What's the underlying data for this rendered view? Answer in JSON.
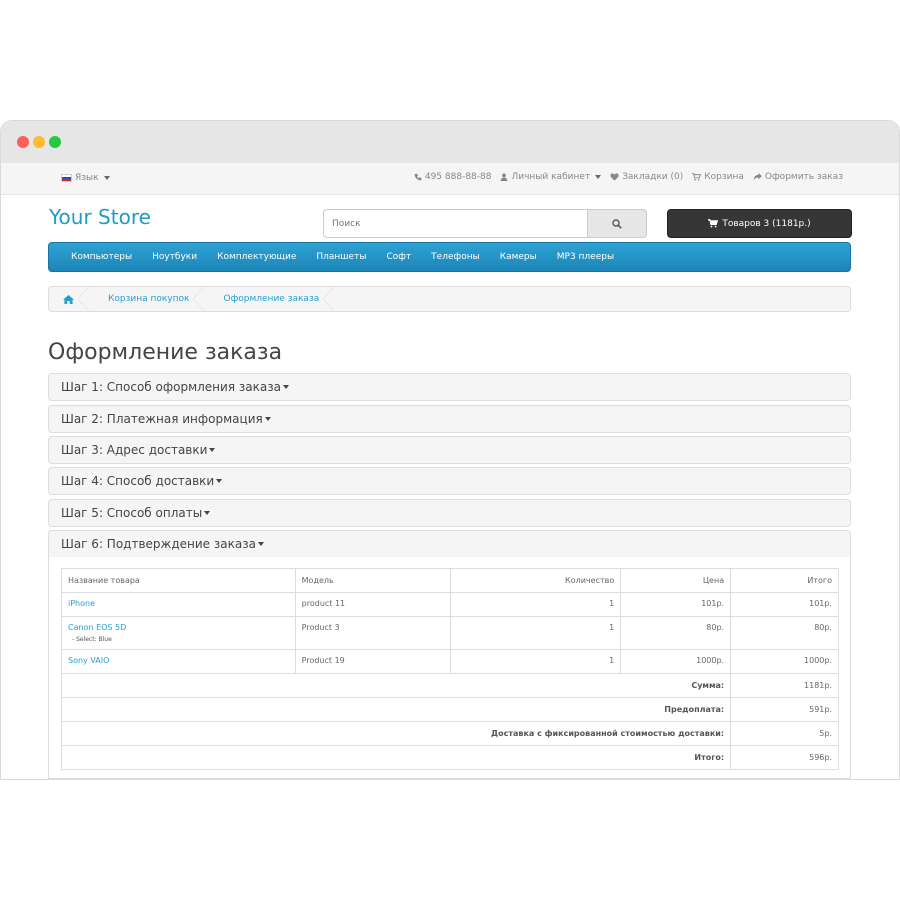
{
  "topbar": {
    "language": "Язык",
    "phone": "495 888-88-88",
    "account": "Личный кабинет",
    "wishlist": "Закладки (0)",
    "cart": "Корзина",
    "checkout": "Оформить заказ"
  },
  "header": {
    "logo": "Your Store",
    "search_placeholder": "Поиск",
    "cart_button": "Товаров 3 (1181р.)"
  },
  "menu": [
    "Компьютеры",
    "Ноутбуки",
    "Комплектующие",
    "Планшеты",
    "Софт",
    "Телефоны",
    "Камеры",
    "MP3 плееры"
  ],
  "breadcrumb": [
    "Корзина покупок",
    "Оформление заказа"
  ],
  "page_title": "Оформление заказа",
  "steps": [
    "Шаг 1: Способ оформления заказа",
    "Шаг 2: Платежная информация",
    "Шаг 3: Адрес доставки",
    "Шаг 4: Способ доставки",
    "Шаг 5: Способ оплаты",
    "Шаг 6: Подтверждение заказа"
  ],
  "table": {
    "headers": [
      "Название товара",
      "Модель",
      "Количество",
      "Цена",
      "Итого"
    ],
    "rows": [
      {
        "name": "iPhone",
        "option": "",
        "model": "product 11",
        "qty": "1",
        "price": "101р.",
        "total": "101р."
      },
      {
        "name": "Canon EOS 5D",
        "option": "- Select: Blue",
        "model": "Product 3",
        "qty": "1",
        "price": "80р.",
        "total": "80р."
      },
      {
        "name": "Sony VAIO",
        "option": "",
        "model": "Product 19",
        "qty": "1",
        "price": "1000р.",
        "total": "1000р."
      }
    ],
    "totals": [
      {
        "label": "Сумма:",
        "value": "1181р."
      },
      {
        "label": "Предоплата:",
        "value": "591р."
      },
      {
        "label": "Доставка с фиксированной стоимостью доставки:",
        "value": "5р."
      },
      {
        "label": "Итого:",
        "value": "596р."
      }
    ]
  },
  "colors": {
    "accent": "#229ac8",
    "menu_bg": "#2ea2d4",
    "cart_button_bg": "#363636"
  }
}
